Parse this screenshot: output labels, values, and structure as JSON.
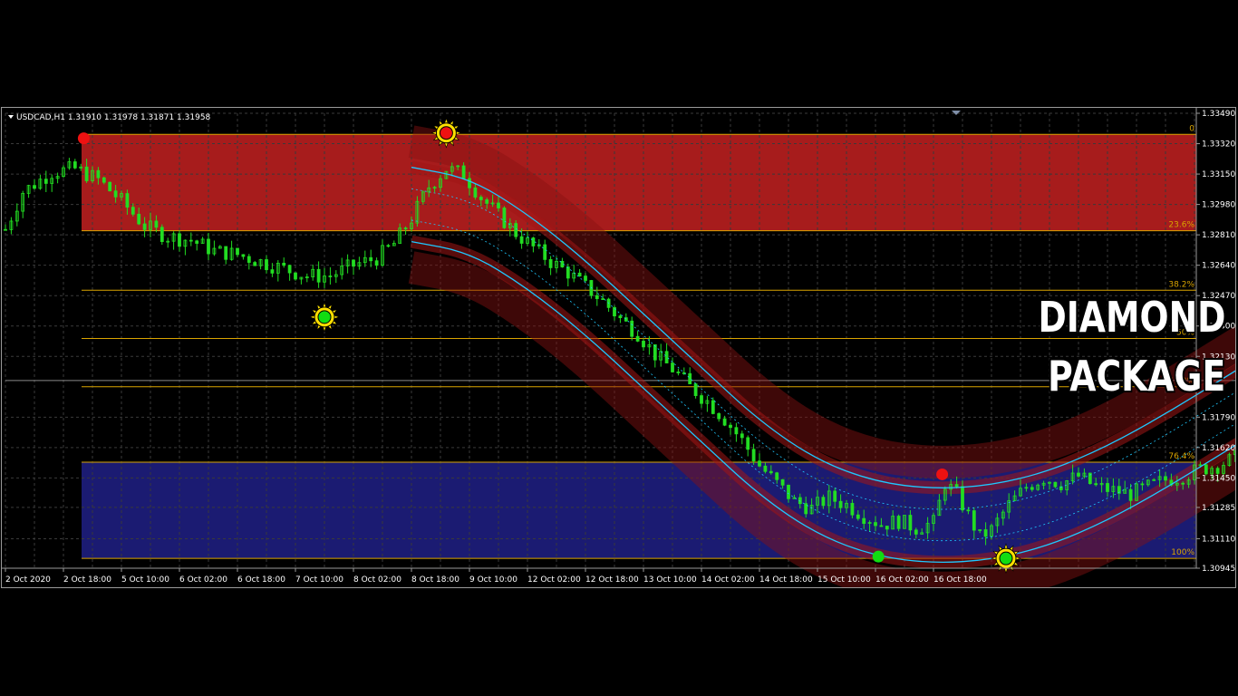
{
  "header": {
    "symbol_info": "USDCAD,H1  1.31910 1.31978 1.31871 1.31958"
  },
  "overlay": {
    "line1": "DIAMOND",
    "line2": "PACKAGE"
  },
  "colors": {
    "background": "#000000",
    "grid": "#3a3a3a",
    "candle": "#22dd22",
    "band_cyan": "#1ec8ff",
    "fib_line": "#d9a400",
    "red_zone": "#b01d1d",
    "blue_zone": "#1c1c78",
    "sell_dot": "#ee1111",
    "buy_dot": "#11dd11"
  },
  "chart_data": {
    "type": "candlestick",
    "symbol": "USDCAD",
    "timeframe": "H1",
    "ohlc_header": {
      "open": 1.3191,
      "high": 1.31978,
      "low": 1.31871,
      "close": 1.31958
    },
    "ylim": [
      1.30945,
      1.3349
    ],
    "price_ticks": [
      "1.33490",
      "1.33320",
      "1.33150",
      "1.32980",
      "1.32810",
      "1.32640",
      "1.32470",
      "1.32300",
      "1.32130",
      "1.31790",
      "1.31620",
      "1.31450",
      "1.31285",
      "1.31110",
      "1.30945"
    ],
    "time_labels": [
      "2 Oct 2020",
      "2 Oct 18:00",
      "5 Oct 10:00",
      "6 Oct 02:00",
      "6 Oct 18:00",
      "7 Oct 10:00",
      "8 Oct 02:00",
      "8 Oct 18:00",
      "9 Oct 10:00",
      "12 Oct 02:00",
      "12 Oct 18:00",
      "13 Oct 10:00",
      "14 Oct 02:00",
      "14 Oct 18:00",
      "15 Oct 10:00",
      "16 Oct 02:00",
      "16 Oct 18:00"
    ],
    "price_path": [
      [
        0,
        1.3284
      ],
      [
        0.3,
        1.3305
      ],
      [
        0.8,
        1.3316
      ],
      [
        1.2,
        1.3318
      ],
      [
        1.6,
        1.3312
      ],
      [
        2.0,
        1.33
      ],
      [
        2.4,
        1.3286
      ],
      [
        2.8,
        1.328
      ],
      [
        3.2,
        1.3278
      ],
      [
        3.6,
        1.3272
      ],
      [
        4.0,
        1.327
      ],
      [
        4.4,
        1.3266
      ],
      [
        4.8,
        1.3262
      ],
      [
        5.2,
        1.3258
      ],
      [
        5.6,
        1.3258
      ],
      [
        6.0,
        1.3264
      ],
      [
        6.4,
        1.3268
      ],
      [
        6.7,
        1.3276
      ],
      [
        7.0,
        1.329
      ],
      [
        7.3,
        1.3308
      ],
      [
        7.6,
        1.3318
      ],
      [
        7.9,
        1.3315
      ],
      [
        8.2,
        1.3302
      ],
      [
        8.5,
        1.3292
      ],
      [
        8.8,
        1.3282
      ],
      [
        9.1,
        1.3274
      ],
      [
        9.4,
        1.3266
      ],
      [
        9.7,
        1.326
      ],
      [
        10.0,
        1.3252
      ],
      [
        10.3,
        1.3244
      ],
      [
        10.6,
        1.3234
      ],
      [
        10.9,
        1.3226
      ],
      [
        11.2,
        1.3214
      ],
      [
        11.5,
        1.3206
      ],
      [
        11.8,
        1.3196
      ],
      [
        12.1,
        1.3188
      ],
      [
        12.4,
        1.3178
      ],
      [
        12.7,
        1.3166
      ],
      [
        13.0,
        1.3152
      ],
      [
        13.3,
        1.3142
      ],
      [
        13.6,
        1.3132
      ],
      [
        13.9,
        1.3128
      ],
      [
        14.2,
        1.3134
      ],
      [
        14.5,
        1.313
      ],
      [
        14.8,
        1.3124
      ],
      [
        15.1,
        1.3119
      ],
      [
        15.4,
        1.3121
      ],
      [
        15.7,
        1.3117
      ],
      [
        16.0,
        1.312
      ],
      [
        16.2,
        1.3142
      ],
      [
        16.4,
        1.3136
      ],
      [
        16.6,
        1.3124
      ],
      [
        16.8,
        1.3112
      ],
      [
        17.0,
        1.3116
      ],
      [
        17.3,
        1.313
      ],
      [
        17.6,
        1.314
      ],
      [
        17.9,
        1.3145
      ],
      [
        18.2,
        1.3142
      ],
      [
        18.5,
        1.3146
      ],
      [
        18.8,
        1.314
      ],
      [
        19.1,
        1.3138
      ],
      [
        19.4,
        1.3136
      ],
      [
        19.7,
        1.314
      ],
      [
        20.0,
        1.3144
      ],
      [
        20.3,
        1.3146
      ],
      [
        20.6,
        1.315
      ],
      [
        20.9,
        1.3152
      ],
      [
        21.2,
        1.3156
      ],
      [
        21.5,
        1.3172
      ],
      [
        21.8,
        1.32
      ],
      [
        22.0,
        1.3226
      ],
      [
        22.2,
        1.324
      ],
      [
        22.4,
        1.3228
      ],
      [
        22.7,
        1.3222
      ],
      [
        23.0,
        1.322
      ],
      [
        23.3,
        1.3226
      ],
      [
        23.6,
        1.3232
      ],
      [
        23.9,
        1.3224
      ],
      [
        24.2,
        1.3212
      ],
      [
        24.5,
        1.3196
      ],
      [
        24.8,
        1.3184
      ],
      [
        25.1,
        1.3192
      ]
    ],
    "zones": [
      {
        "name": "red",
        "from": 1.33372,
        "to": 1.32833
      },
      {
        "name": "blue",
        "from": 1.31538,
        "to": 1.31
      }
    ],
    "fib_levels": [
      {
        "label": "0",
        "price": 1.33372
      },
      {
        "label": "23.6%",
        "price": 1.32833
      },
      {
        "label": "38.2%",
        "price": 1.325
      },
      {
        "label": "50%",
        "price": 1.3223
      },
      {
        "label": "61.8%",
        "price": 1.3196
      },
      {
        "label": "76.4%",
        "price": 1.31538
      },
      {
        "label": "100%",
        "price": 1.31
      }
    ],
    "current_price": 1.31995,
    "band_center": [
      [
        7,
        1.3298
      ],
      [
        8,
        1.3292
      ],
      [
        9,
        1.3272
      ],
      [
        10,
        1.3246
      ],
      [
        11,
        1.3216
      ],
      [
        12,
        1.3186
      ],
      [
        13,
        1.3156
      ],
      [
        14,
        1.3134
      ],
      [
        15,
        1.3122
      ],
      [
        16,
        1.3118
      ],
      [
        17,
        1.312
      ],
      [
        18,
        1.3128
      ],
      [
        19,
        1.3142
      ],
      [
        20,
        1.316
      ],
      [
        21,
        1.318
      ],
      [
        22,
        1.32
      ],
      [
        23,
        1.3212
      ],
      [
        24,
        1.321
      ],
      [
        25,
        1.3188
      ],
      [
        26,
        1.314
      ],
      [
        27,
        1.306
      ]
    ],
    "band_offset": 0.0016,
    "signals": [
      {
        "type": "sell",
        "x": 1.35,
        "price": 1.3335,
        "sun": false
      },
      {
        "type": "sell",
        "x": 7.6,
        "price": 1.3338,
        "sun": true
      },
      {
        "type": "buy",
        "x": 5.5,
        "price": 1.3235,
        "sun": true
      },
      {
        "type": "sell",
        "x": 21.85,
        "price": 1.3243,
        "sun": true
      },
      {
        "type": "sell",
        "x": 16.15,
        "price": 1.3147,
        "sun": false
      },
      {
        "type": "buy",
        "x": 15.05,
        "price": 1.3101,
        "sun": false
      },
      {
        "type": "buy",
        "x": 17.25,
        "price": 1.31,
        "sun": true
      }
    ]
  }
}
